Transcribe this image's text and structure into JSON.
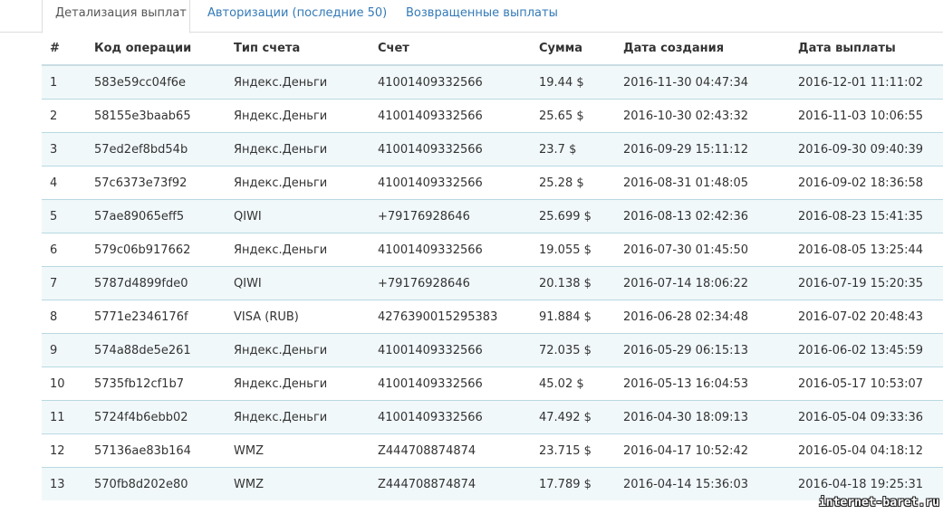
{
  "tabs": [
    {
      "label": "Детализация выплат",
      "active": true
    },
    {
      "label": "Авторизации (последние 50)",
      "active": false
    },
    {
      "label": "Возвращенные выплаты",
      "active": false
    }
  ],
  "table": {
    "headers": [
      "#",
      "Код операции",
      "Тип счета",
      "Счет",
      "Сумма",
      "Дата создания",
      "Дата выплаты"
    ],
    "rows": [
      [
        "1",
        "583e59cc04f6e",
        "Яндекс.Деньги",
        "41001409332566",
        "19.44 $",
        "2016-11-30 04:47:34",
        "2016-12-01 11:11:02"
      ],
      [
        "2",
        "58155e3baab65",
        "Яндекс.Деньги",
        "41001409332566",
        "25.65 $",
        "2016-10-30 02:43:32",
        "2016-11-03 10:06:55"
      ],
      [
        "3",
        "57ed2ef8bd54b",
        "Яндекс.Деньги",
        "41001409332566",
        "23.7 $",
        "2016-09-29 15:11:12",
        "2016-09-30 09:40:39"
      ],
      [
        "4",
        "57c6373e73f92",
        "Яндекс.Деньги",
        "41001409332566",
        "25.28 $",
        "2016-08-31 01:48:05",
        "2016-09-02 18:36:58"
      ],
      [
        "5",
        "57ae89065eff5",
        "QIWI",
        "+79176928646",
        "25.699 $",
        "2016-08-13 02:42:36",
        "2016-08-23 15:41:35"
      ],
      [
        "6",
        "579c06b917662",
        "Яндекс.Деньги",
        "41001409332566",
        "19.055 $",
        "2016-07-30 01:45:50",
        "2016-08-05 13:25:44"
      ],
      [
        "7",
        "5787d4899fde0",
        "QIWI",
        "+79176928646",
        "20.138 $",
        "2016-07-14 18:06:22",
        "2016-07-19 15:20:35"
      ],
      [
        "8",
        "5771e2346176f",
        "VISA (RUB)",
        "4276390015295383",
        "91.884 $",
        "2016-06-28 02:34:48",
        "2016-07-02 20:48:43"
      ],
      [
        "9",
        "574a88de5e261",
        "Яндекс.Деньги",
        "41001409332566",
        "72.035 $",
        "2016-05-29 06:15:13",
        "2016-06-02 13:45:59"
      ],
      [
        "10",
        "5735fb12cf1b7",
        "Яндекс.Деньги",
        "41001409332566",
        "45.02 $",
        "2016-05-13 16:04:53",
        "2016-05-17 10:53:07"
      ],
      [
        "11",
        "5724f4b6ebb02",
        "Яндекс.Деньги",
        "41001409332566",
        "47.492 $",
        "2016-04-30 18:09:13",
        "2016-05-04 09:33:36"
      ],
      [
        "12",
        "57136ae83b164",
        "WMZ",
        "Z444708874874",
        "23.715 $",
        "2016-04-17 10:52:42",
        "2016-05-04 04:18:12"
      ],
      [
        "13",
        "570fb8d202e80",
        "WMZ",
        "Z444708874874",
        "17.789 $",
        "2016-04-14 15:36:03",
        "2016-04-18 19:25:31"
      ]
    ]
  },
  "watermark": "internet-baret.ru",
  "colors": {
    "link": "#337ab7",
    "row_stripe": "#f1f8fa",
    "row_border": "#b7d9e2"
  }
}
